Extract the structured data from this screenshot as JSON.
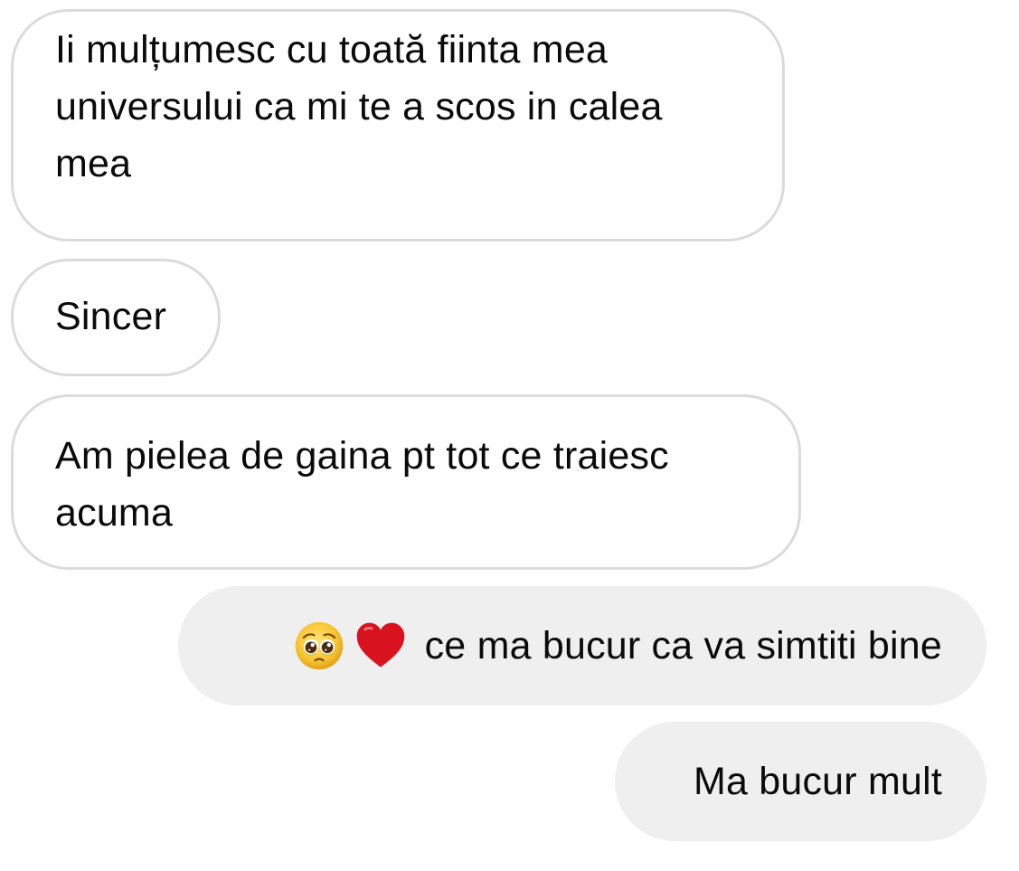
{
  "conversation": {
    "messages": [
      {
        "direction": "incoming",
        "text": "Ii mulțumesc cu toată fiinta mea universului ca mi te a scos in calea mea"
      },
      {
        "direction": "incoming",
        "text": "Sincer"
      },
      {
        "direction": "incoming",
        "text": "Am pielea de gaina pt tot ce traiesc acuma"
      },
      {
        "direction": "outgoing",
        "emojis": [
          "pleading-face-emoji",
          "red-heart-emoji"
        ],
        "text": "ce ma bucur ca va simtiti bine"
      },
      {
        "direction": "outgoing",
        "text": "Ma bucur mult"
      }
    ]
  },
  "colors": {
    "incoming_bubble_border": "#dbdbdb",
    "outgoing_bubble_bg": "#efefef",
    "text": "#0a0a0a",
    "heart": "#d8131f",
    "emoji_face": "#f7c531"
  }
}
